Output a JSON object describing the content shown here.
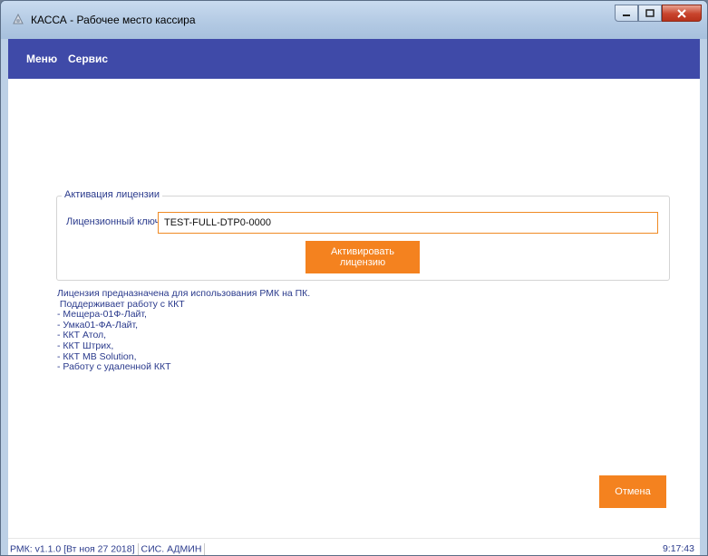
{
  "window": {
    "title": "КАССА - Рабочее место кассира"
  },
  "menu": {
    "items": [
      "Меню",
      "Сервис"
    ]
  },
  "license": {
    "group_title": "Активация лицензии",
    "key_label": "Лицензионный ключ",
    "key_value": "TEST-FULL-DTP0-0000",
    "activate_label": "Активировать лицензию"
  },
  "info": {
    "lines": [
      "Лицензия предназначена для использования РМК на ПК.",
      " Поддерживает работу с ККТ",
      "- Мещера-01Ф-Лайт,",
      "- Умка01-ФА-Лайт,",
      "- ККТ Атол,",
      "- ККТ Штрих,",
      "- ККТ MB Solution,",
      "- Работу с удаленной ККТ"
    ]
  },
  "actions": {
    "cancel_label": "Отмена"
  },
  "status": {
    "version": "РМК: v1.1.0 [Вт ноя 27 2018]",
    "user": "СИС. АДМИН",
    "time": "9:17:43"
  },
  "colors": {
    "accent": "#f4821f",
    "menubar": "#3f4aa8",
    "text": "#2a3a8c"
  }
}
